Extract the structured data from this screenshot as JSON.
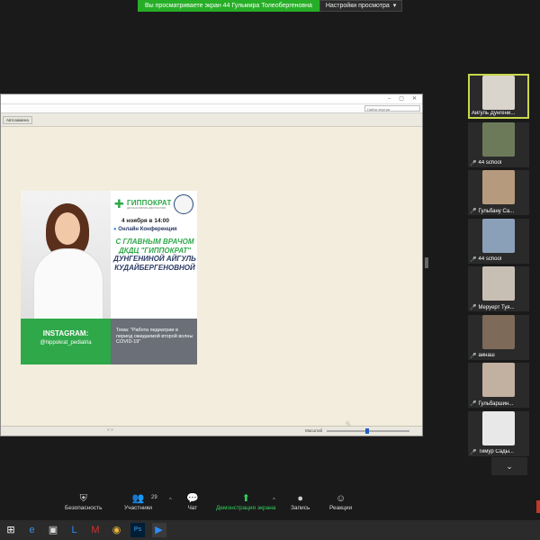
{
  "banner": {
    "message": "Вы просматриваете экран 44 Гульмира Толеобергеновна",
    "view_options": "Настройки просмотра",
    "chevron_icon": "chevron-down-icon"
  },
  "shared_window": {
    "win_controls": [
      "–",
      "▢",
      "✕"
    ],
    "search_placeholder": "Найти внутри",
    "tab_label": "Автозамена",
    "zoom_label": "Масштаб",
    "zoom_level": 0.47,
    "nav_arrows": "« »"
  },
  "poster": {
    "brand": "ГИППОКРАТ",
    "brand_tagline": "ДЕТСКАЯ КЛИНИКА ДИАГНОСТИКИ",
    "date": "4 ноября   в 14:00",
    "online": "Онлайн Конференция",
    "headline_green": "С ГЛАВНЫМ ВРАЧОМ ДКДЦ \"ГИППОКРАТ\"",
    "headline_blue": "ДУНГЕНИНОЙ АЙГУЛЬ КУДАЙБЕРГЕНОВНОЙ",
    "instagram_title": "INSTAGRAM:",
    "instagram_handle": "@hippokrat_pediatria",
    "topic": "Тема: \"Работа педиатрии в период ожидаемой второй волны COVID-19\""
  },
  "participants": [
    {
      "name": "Айгуль Дунгени...",
      "muted": false,
      "active": true,
      "bg": "#d9d4cc"
    },
    {
      "name": "44 school",
      "muted": true,
      "active": false,
      "bg": "#6c7a5a"
    },
    {
      "name": "Гульбану Са...",
      "muted": true,
      "active": false,
      "bg": "#b69a7e"
    },
    {
      "name": "44 school",
      "muted": true,
      "active": false,
      "bg": "#8aa0b8"
    },
    {
      "name": "Меруерт Туя...",
      "muted": true,
      "active": false,
      "bg": "#c8bfb4"
    },
    {
      "name": "айнаш",
      "muted": true,
      "active": false,
      "bg": "#7d6a58"
    },
    {
      "name": "Гульбаршин...",
      "muted": true,
      "active": false,
      "bg": "#c2b0a0"
    },
    {
      "name": "Тимур Сады...",
      "muted": true,
      "active": false,
      "bg": "#e8e8e8"
    }
  ],
  "toolbar": {
    "security": "Безопасность",
    "participants": "Участники",
    "participants_count": "29",
    "chat": "Чат",
    "share": "Демонстрация экрана",
    "record": "Запись",
    "reactions": "Реакции"
  },
  "taskbar": [
    "windows-logo-icon",
    "edge-icon",
    "store-icon",
    "lync-icon",
    "mcafee-icon",
    "chrome-icon",
    "photoshop-icon",
    "zoom-icon"
  ]
}
